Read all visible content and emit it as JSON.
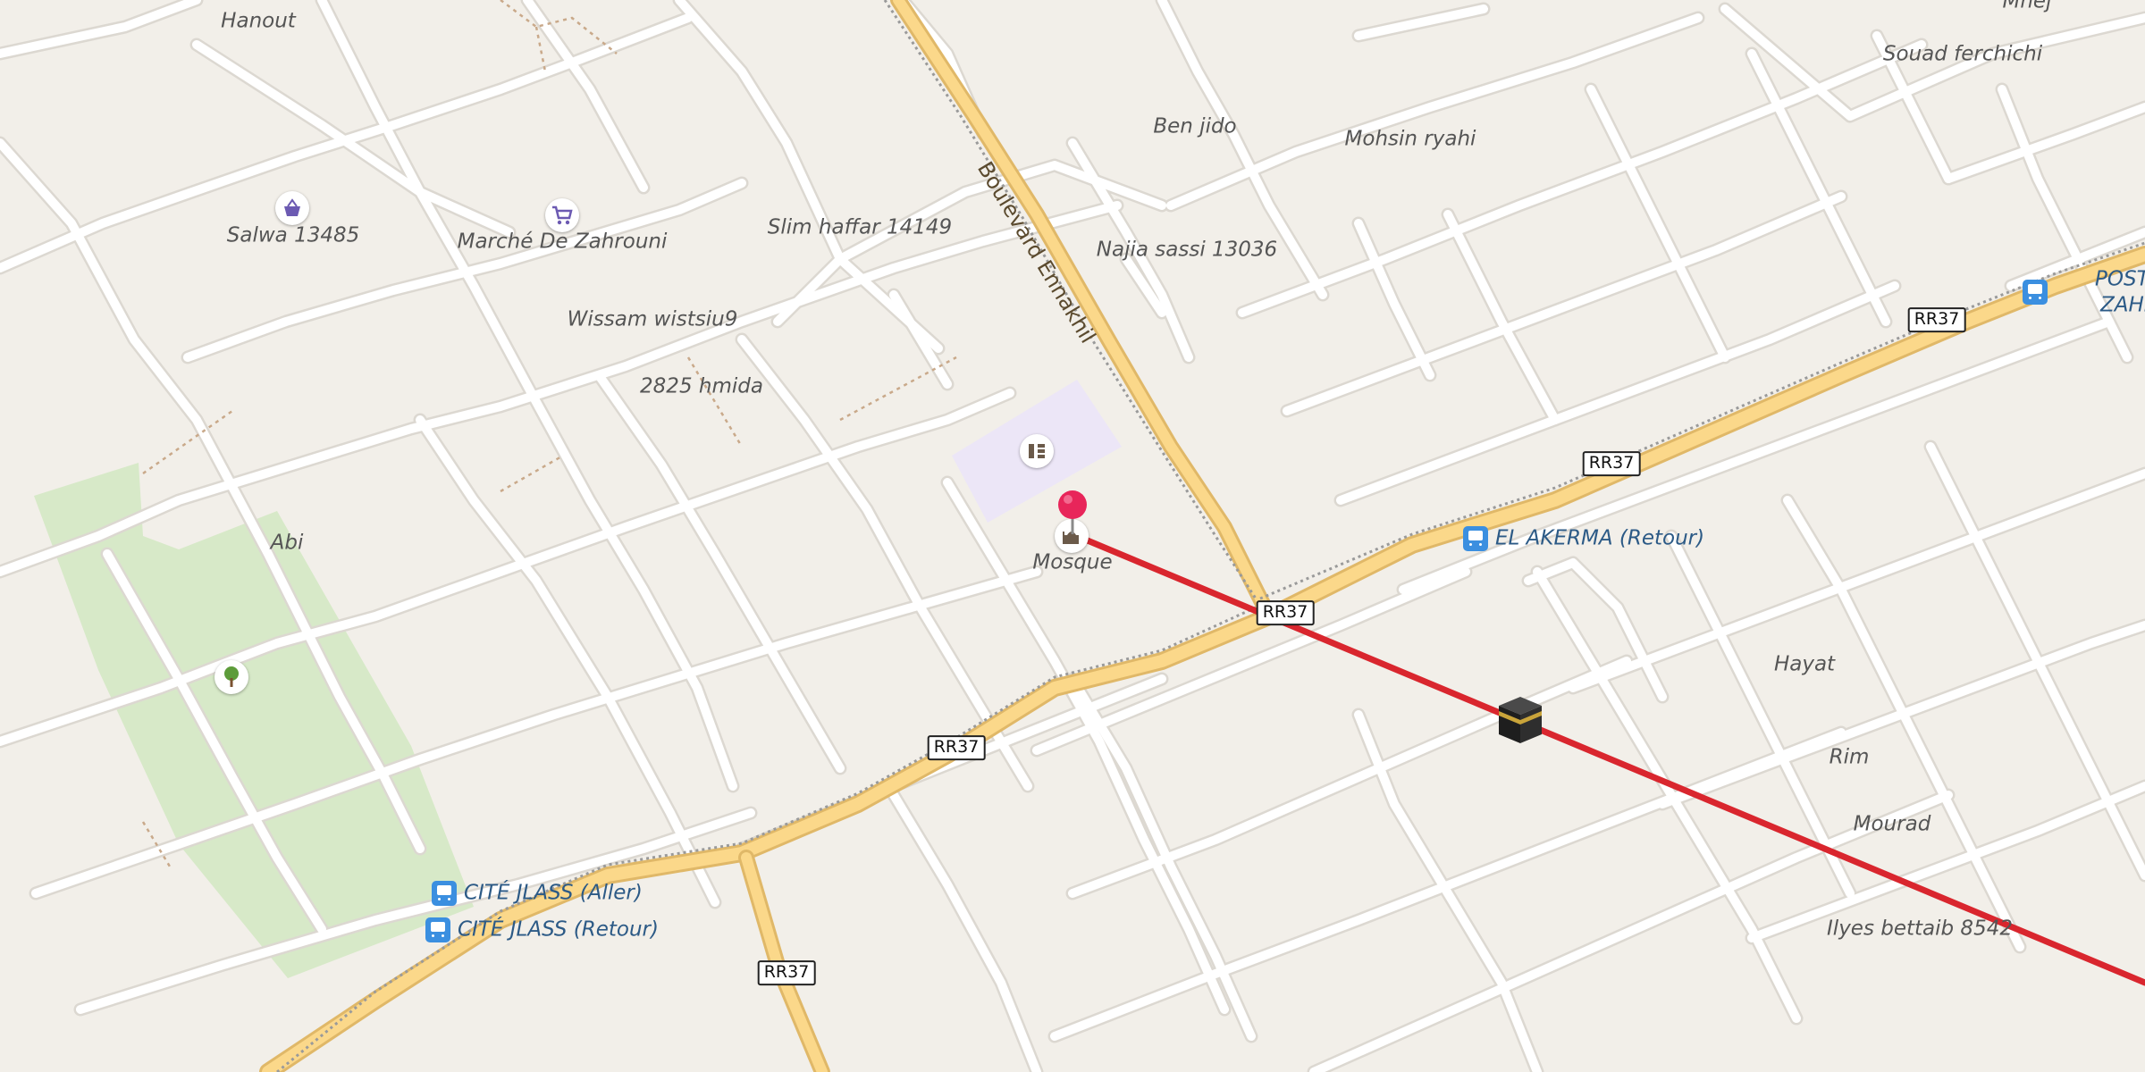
{
  "map": {
    "road_names": {
      "boulevard": "Boulevard Ennakhil"
    },
    "route_shields": [
      "RR37",
      "RR37",
      "RR37",
      "RR37",
      "RR37"
    ],
    "place_labels": {
      "hanout": "Hanout",
      "salwa": "Salwa 13485",
      "marche": "Marché De Zahrouni",
      "slim": "Slim haffar 14149",
      "wissam": "Wissam wistsiu9",
      "hmida": "2825 hmida",
      "abi": "Abi",
      "ben_jido": "Ben jido",
      "mohsin": "Mohsin ryahi",
      "najia": "Najia sassi 13036",
      "souad": "Souad ferchichi",
      "mhej": "Mhej",
      "hayat": "Hayat",
      "rim": "Rim",
      "mourad": "Mourad",
      "ilyes": "Ilyes bettaib 8542",
      "mosque": "Mosque"
    },
    "bus_stops": {
      "cite_aller": "CITÉ JLASS (Aller)",
      "cite_retour": "CITÉ JLASS (Retour)",
      "akerma": "EL AKERMA (Retour)",
      "poste_line1": "POSTE PO",
      "poste_line2": "ZAHROUN"
    },
    "icons": {
      "marker": "location-pin-icon",
      "kaaba": "kaaba-icon",
      "park": "tree-icon",
      "shop": "basket-icon",
      "market": "cart-icon",
      "school": "school-icon",
      "mosque": "mosque-icon",
      "bus": "bus-stop-icon"
    },
    "colors": {
      "background": "#f2efe9",
      "minor_road": "#ffffff",
      "road_casing": "#dcd8d1",
      "primary_road": "#fbd88a",
      "primary_casing": "#e0b868",
      "park": "#d7e9c8",
      "school_area": "#ece6f7",
      "qibla_line": "#d9262e",
      "pin": "#e8255a",
      "bus_label": "#2c5a86"
    }
  }
}
